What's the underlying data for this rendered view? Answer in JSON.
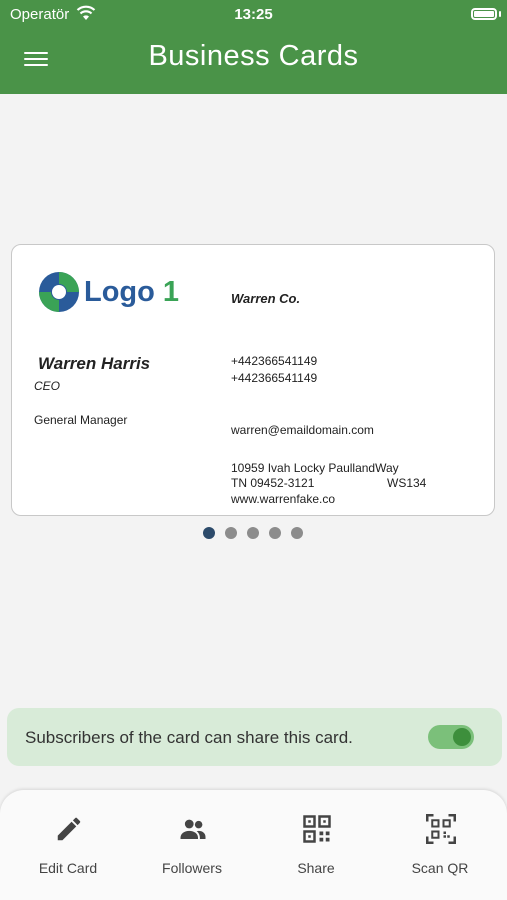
{
  "status_bar": {
    "carrier": "Operatör",
    "time": "13:25"
  },
  "header": {
    "title": "Business Cards"
  },
  "card": {
    "logo_text": "Logo",
    "logo_number": "1",
    "company": "Warren Co.",
    "name": "Warren Harris",
    "role": "CEO",
    "position": "General Manager",
    "phone1": "+442366541149",
    "phone2": "+442366541149",
    "email": "warren@emaildomain.com",
    "address_line1": "10959 Ivah Locky PaullandWay",
    "address_line2": "TN 09452-3121",
    "address_code": "WS134",
    "website": "www.warrenfake.co"
  },
  "pagination": {
    "count": 5,
    "active": 0
  },
  "share_setting": {
    "text": "Subscribers of the card can share this card.",
    "enabled": true
  },
  "tabs": [
    {
      "label": "Edit Card",
      "icon": "pencil-icon"
    },
    {
      "label": "Followers",
      "icon": "people-icon"
    },
    {
      "label": "Share",
      "icon": "qr-code-icon"
    },
    {
      "label": "Scan QR",
      "icon": "scan-qr-icon"
    }
  ],
  "colors": {
    "primary": "#4a9348",
    "share_bg": "#d8ebd8",
    "dot_active": "#2c4a6a"
  }
}
